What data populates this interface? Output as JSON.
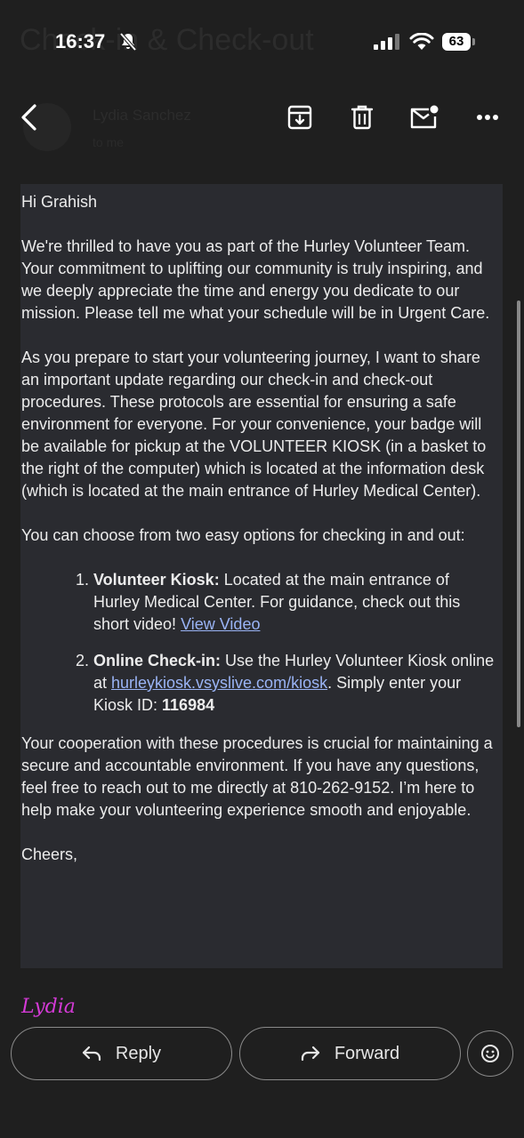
{
  "status_bar": {
    "time": "16:37",
    "battery": "63",
    "ghost_subject": "Check-in & Check-out"
  },
  "toolbar": {
    "ghost_sender": "Lydia Sanchez",
    "ghost_meta": "to me"
  },
  "email": {
    "greeting": "Hi Grahish",
    "para1": "We're thrilled to have you as part of the Hurley Volunteer Team. Your commitment to uplifting our community is truly inspiring, and we deeply appreciate the time and energy you dedicate to our mission. Please tell me what your schedule will be in Urgent Care.",
    "para2": "As you prepare to start your volunteering journey, I want to share an important update regarding our check-in and check-out procedures. These protocols are essential for ensuring a safe environment for everyone.  For your convenience, your badge will be available for pickup at the VOLUNTEER KIOSK (in a basket to the right of the computer) which is located at the information desk (which is located at the main entrance of Hurley Medical Center).",
    "para3": "You can choose from two easy options for checking in and out:",
    "options": [
      {
        "title": "Volunteer Kiosk:",
        "text": " Located at the main entrance of Hurley Medical Center. For guidance, check out this short video! ",
        "link": "View Video"
      },
      {
        "title": "Online Check-in:",
        "text": " Use the Hurley Volunteer Kiosk online at ",
        "link": "hurleykiosk.vsyslive.com/kiosk",
        "text2": ". Simply enter your Kiosk ID: ",
        "kiosk_id": "116984"
      }
    ],
    "para4": "Your cooperation with these procedures is crucial for maintaining a secure and accountable environment. If you have any questions, feel free to reach out to me directly at 810-262-9152. I’m here to help make your volunteering experience smooth and enjoyable.",
    "closing": "Cheers,",
    "signature": "Lydia"
  },
  "actions": {
    "reply": "Reply",
    "forward": "Forward"
  }
}
